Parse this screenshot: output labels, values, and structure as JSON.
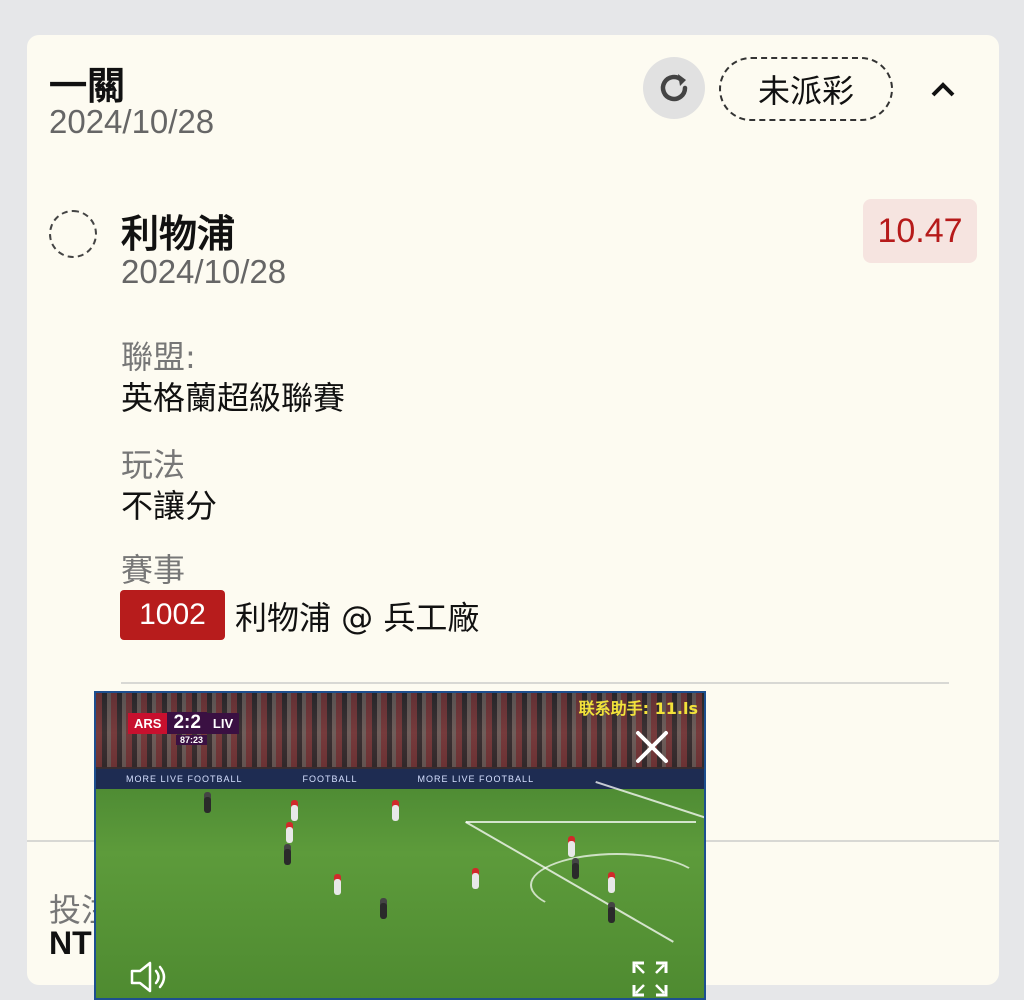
{
  "bet": {
    "type": "一關",
    "date": "2024/10/28",
    "status": "未派彩"
  },
  "selection": {
    "team": "利物浦",
    "date": "2024/10/28",
    "odds": "10.47",
    "league_label": "聯盟:",
    "league": "英格蘭超級聯賽",
    "play_label": "玩法",
    "play_type": "不讓分",
    "match_label": "賽事",
    "match_id": "1002",
    "match_name": "利物浦 @ 兵工廠"
  },
  "stake": {
    "label_partial": "投注",
    "value_partial": "NT"
  },
  "video": {
    "scoreboard": {
      "home": "ARS",
      "score": "2:2",
      "away": "LIV",
      "clock": "87:23"
    },
    "watermark": "联系助手: 11.ls",
    "ads": [
      "MORE LIVE FOOTBALL",
      "FOOTBALL",
      "MORE LIVE FOOTBALL"
    ]
  },
  "icons": {
    "refresh": "refresh-icon",
    "collapse": "chevron-up-icon",
    "close": "close-icon",
    "mute": "speaker-icon",
    "fullscreen": "fullscreen-icon"
  },
  "colors": {
    "accent_red": "#b71c1c",
    "odds_bg": "#f6e4e0",
    "card_bg": "#fdfbf1"
  }
}
